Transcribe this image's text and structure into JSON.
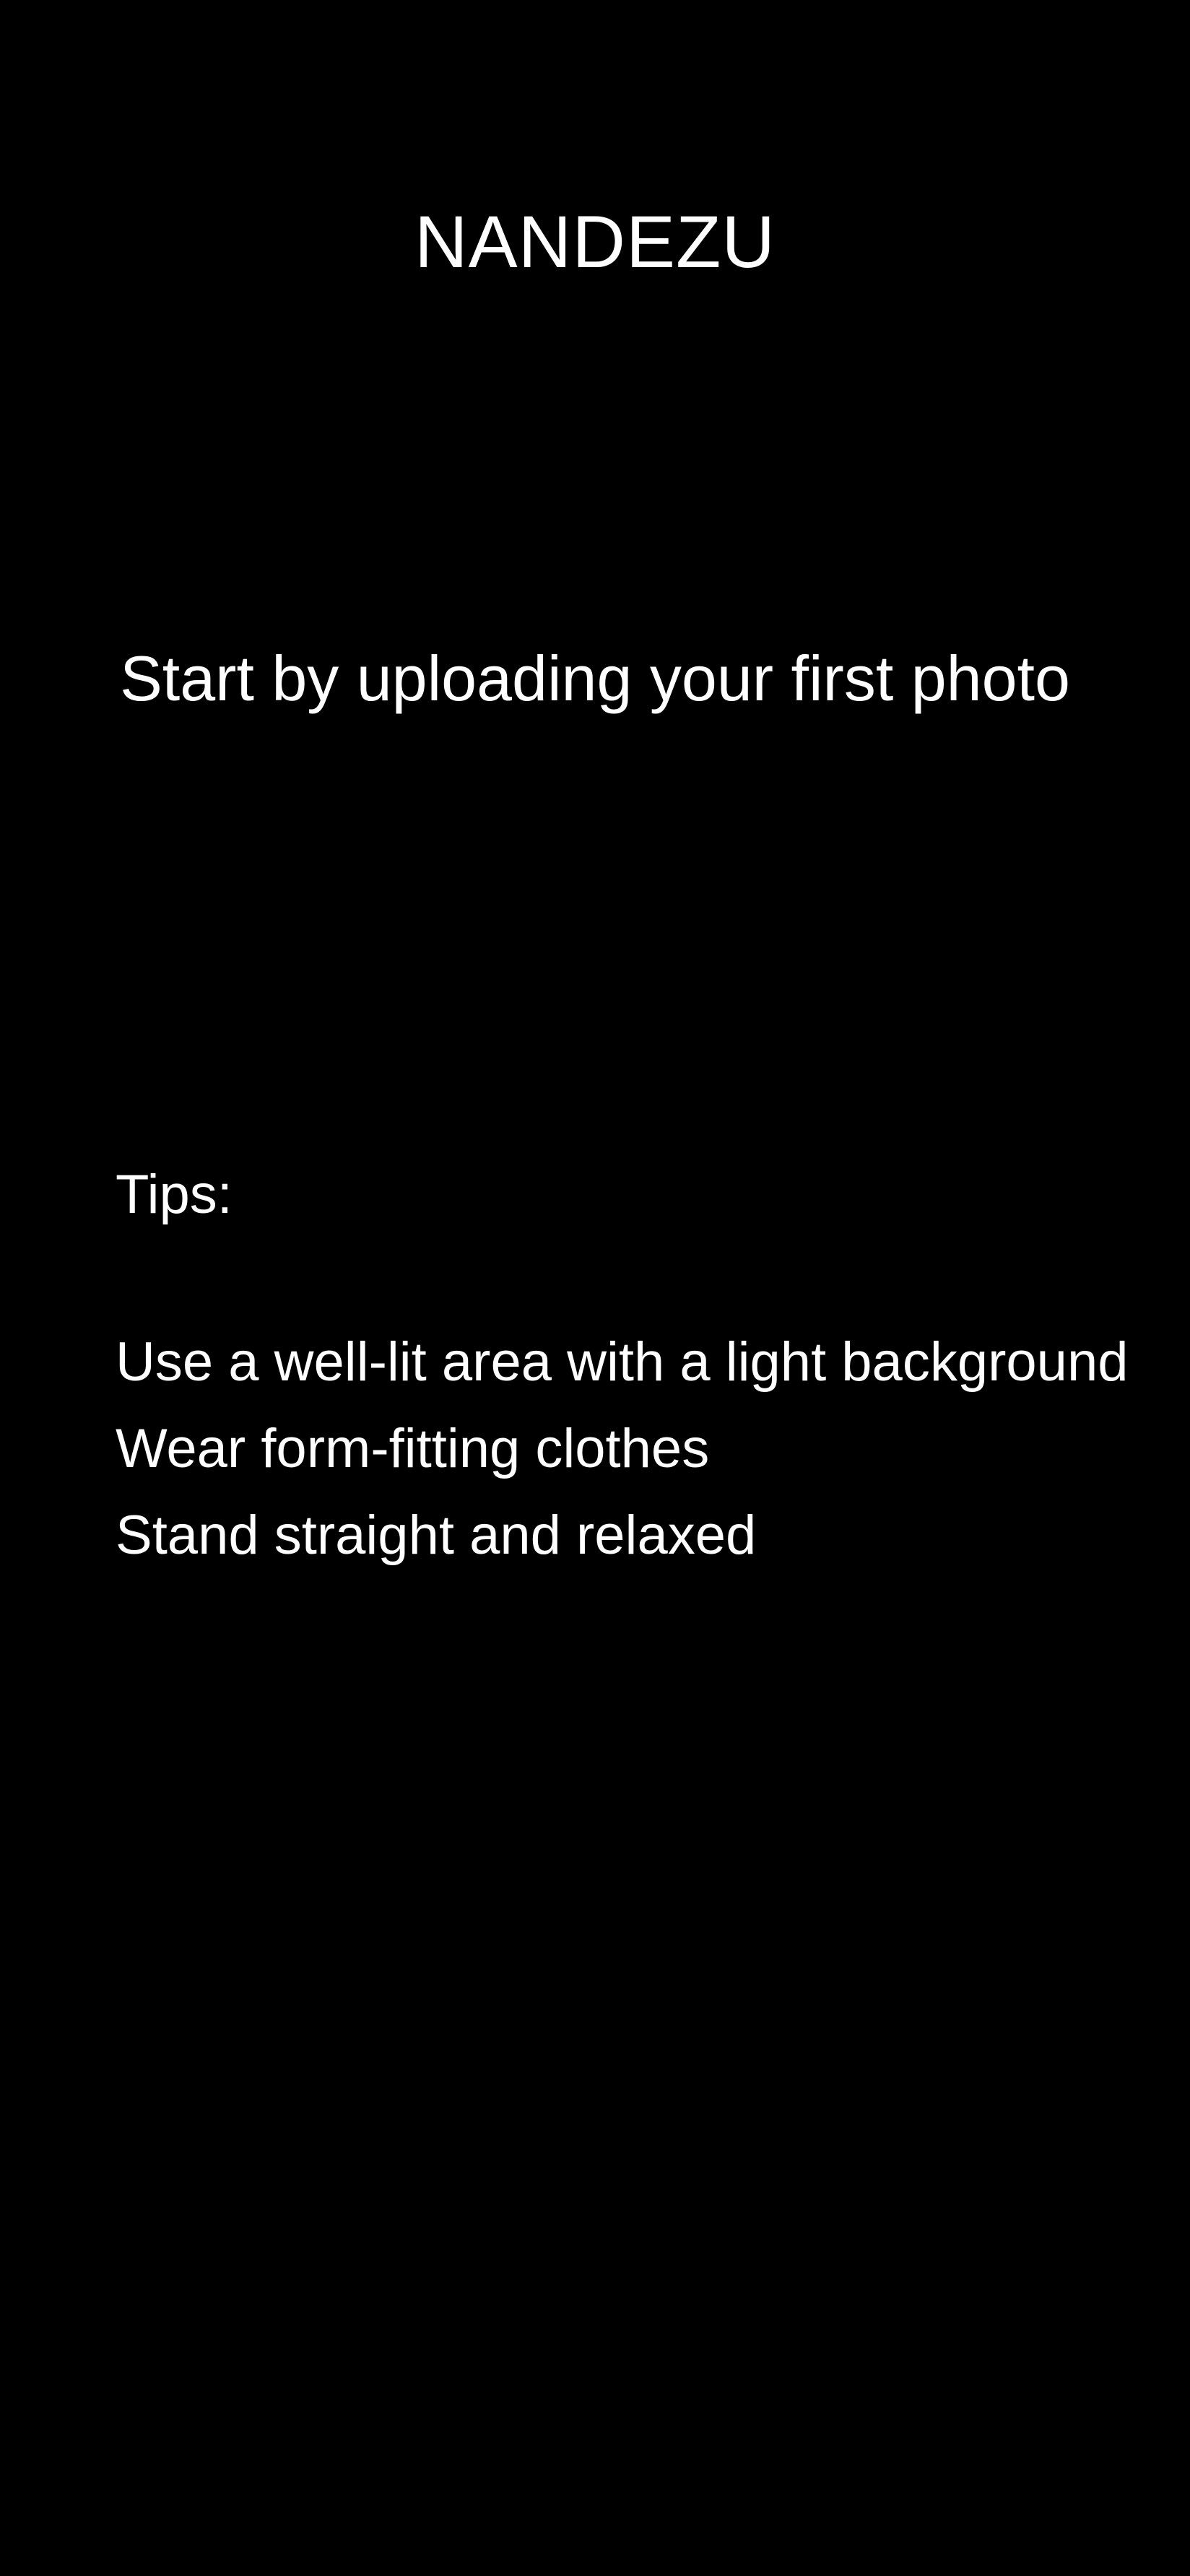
{
  "app": {
    "title": "NANDEZU"
  },
  "upload": {
    "prompt": "Start by uploading your first photo"
  },
  "tips": {
    "heading": "Tips:",
    "items": [
      "Use a well-lit area with a light background",
      "Wear form-fitting clothes",
      "Stand straight and relaxed"
    ]
  },
  "colors": {
    "background": "#000000",
    "text": "#ffffff"
  }
}
